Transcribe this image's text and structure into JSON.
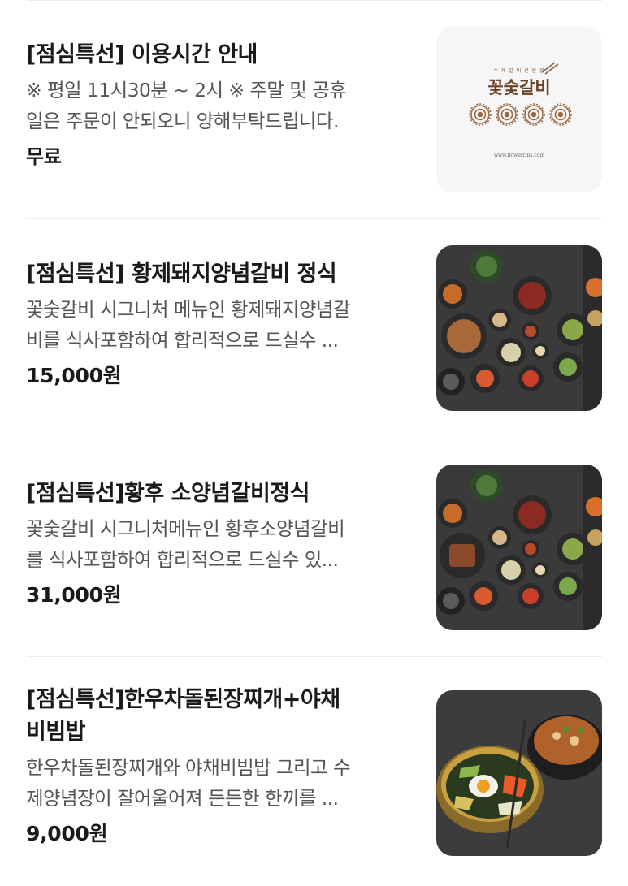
{
  "menu_items": [
    {
      "title": "[점심특선] 이용시간 안내",
      "desc_line1": "※ 평일 11시30분 ~ 2시 ※ 주말 및 공휴",
      "desc_line2": "일은 주문이 안되오니 양해부탁드립니다.",
      "price": "무료",
      "image": "flowerribs-logo",
      "logo_text": "꽃숯갈비",
      "logo_url": "www.flowerribs.com"
    },
    {
      "title": "[점심특선] 황제돼지양념갈비 정식",
      "desc_line1": "꽃숯갈비 시그니처 메뉴인 황제돼지양념갈",
      "desc_line2": "비를 식사포함하여 합리적으로 드실수 ...",
      "price": "15,000원",
      "image": "korean-banchan-table-photo"
    },
    {
      "title": "[점심특선]황후 소양념갈비정식",
      "desc_line1": "꽃숯갈비 시그니처메뉴인 황후소양념갈비",
      "desc_line2": "를 식사포함하여 합리적으로 드실수 있...",
      "price": "31,000원",
      "image": "korean-banchan-table-photo"
    },
    {
      "title_line1": "[점심특선]한우차돌된장찌개+야채",
      "title_line2": "비빔밥",
      "desc_line1": "한우차돌된장찌개와 야채비빔밥 그리고 수",
      "desc_line2": "제양념장이 잘어울어져 든든한 한끼를 ...",
      "price": "9,000원",
      "image": "bibimbap-doenjang-stew-photo"
    }
  ],
  "colors": {
    "title": "#1a1a1a",
    "description": "#555555",
    "divider": "#ececec",
    "logo_brown": "#7a4a2a"
  }
}
